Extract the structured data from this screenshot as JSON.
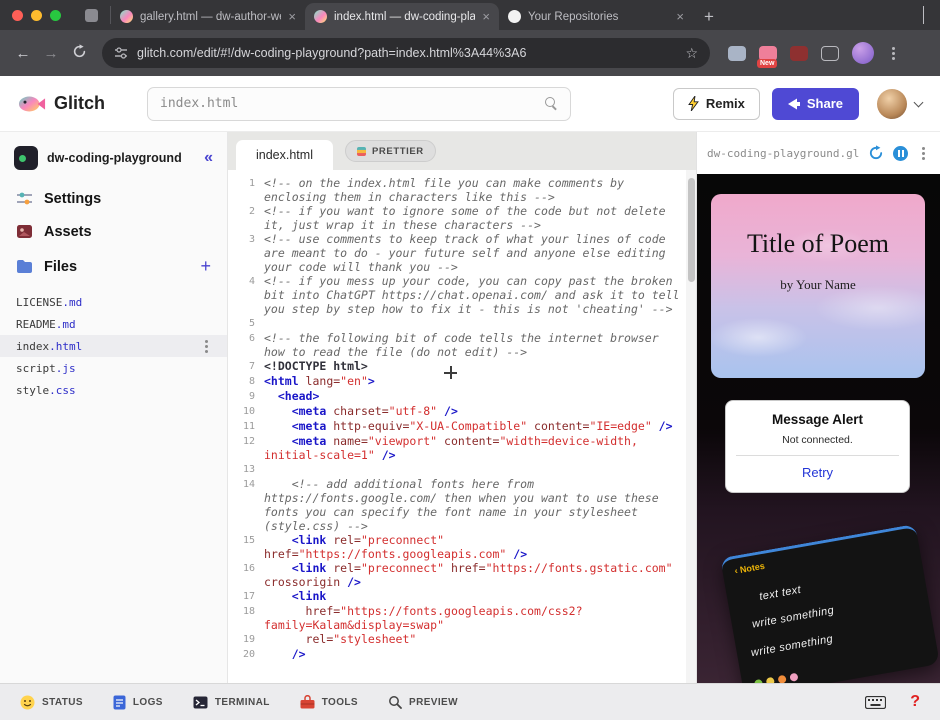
{
  "browser": {
    "tabs": [
      {
        "label": ""
      },
      {
        "label": "gallery.html — dw-author-wel"
      },
      {
        "label": "index.html — dw-coding-play"
      },
      {
        "label": "Your Repositories"
      }
    ],
    "url": "glitch.com/edit/#!/dw-coding-playground?path=index.html%3A44%3A6"
  },
  "header": {
    "brand": "Glitch",
    "search_value": "index.html",
    "remix_label": "Remix",
    "share_label": "Share"
  },
  "sidebar": {
    "project_name": "dw-coding-playground",
    "collapse": "«",
    "nav": [
      {
        "label": "Settings"
      },
      {
        "label": "Assets"
      },
      {
        "label": "Files"
      }
    ],
    "plus": "+",
    "files": [
      {
        "base": "LICENSE",
        "ext": ".md"
      },
      {
        "base": "README",
        "ext": ".md"
      },
      {
        "base": "index",
        "ext": ".html"
      },
      {
        "base": "script",
        "ext": ".js"
      },
      {
        "base": "style",
        "ext": ".css"
      }
    ]
  },
  "editor": {
    "tab_label": "index.html",
    "prettier_label": "PRETTIER",
    "code": [
      {
        "n": "1",
        "segs": [
          {
            "t": "c",
            "s": "<!-- on the index.html file you can make comments by enclosing them in characters like this -->"
          }
        ]
      },
      {
        "n": "2",
        "segs": [
          {
            "t": "c",
            "s": "<!-- if you want to ignore some of the code but not delete it, just wrap it in these characters -->"
          }
        ]
      },
      {
        "n": "3",
        "segs": [
          {
            "t": "c",
            "s": "<!-- use comments to keep track of what your lines of code are meant to do - your future self and anyone else editing your code will thank you -->"
          }
        ]
      },
      {
        "n": "4",
        "segs": [
          {
            "t": "c",
            "s": "<!-- if you mess up your code, you can copy past the broken bit into ChatGPT https://chat.openai.com/ and ask it to tell you step by step how to fix it - this is not 'cheating' -->"
          }
        ]
      },
      {
        "n": "5",
        "segs": []
      },
      {
        "n": "6",
        "segs": [
          {
            "t": "c",
            "s": "<!-- the following bit of code tells the internet browser how to read the file (do not edit) -->"
          }
        ]
      },
      {
        "n": "7",
        "segs": [
          {
            "t": "m",
            "s": "<!DOCTYPE html>"
          }
        ]
      },
      {
        "n": "8",
        "segs": [
          {
            "t": "t",
            "s": "<html"
          },
          {
            "t": "a",
            "s": " lang="
          },
          {
            "t": "s",
            "s": "\"en\""
          },
          {
            "t": "t",
            "s": ">"
          }
        ]
      },
      {
        "n": "9",
        "segs": [
          {
            "t": "p",
            "s": "  "
          },
          {
            "t": "t",
            "s": "<head>"
          }
        ]
      },
      {
        "n": "10",
        "segs": [
          {
            "t": "p",
            "s": "    "
          },
          {
            "t": "t",
            "s": "<meta"
          },
          {
            "t": "a",
            "s": " charset="
          },
          {
            "t": "s",
            "s": "\"utf-8\""
          },
          {
            "t": "t",
            "s": " />"
          }
        ]
      },
      {
        "n": "11",
        "segs": [
          {
            "t": "p",
            "s": "    "
          },
          {
            "t": "t",
            "s": "<meta"
          },
          {
            "t": "a",
            "s": " http-equiv="
          },
          {
            "t": "s",
            "s": "\"X-UA-Compatible\""
          },
          {
            "t": "a",
            "s": " content="
          },
          {
            "t": "s",
            "s": "\"IE=edge\""
          },
          {
            "t": "t",
            "s": " />"
          }
        ]
      },
      {
        "n": "12",
        "segs": [
          {
            "t": "p",
            "s": "    "
          },
          {
            "t": "t",
            "s": "<meta"
          },
          {
            "t": "a",
            "s": " name="
          },
          {
            "t": "s",
            "s": "\"viewport\""
          },
          {
            "t": "a",
            "s": " content="
          },
          {
            "t": "s",
            "s": "\"width=device-width, initial-scale=1\""
          },
          {
            "t": "t",
            "s": " />"
          }
        ]
      },
      {
        "n": "13",
        "segs": []
      },
      {
        "n": "14",
        "segs": [
          {
            "t": "c",
            "s": "    <!-- add additional fonts here from https://fonts.google.com/ then when you want to use these fonts you can specify the font name in your stylesheet (style.css) -->"
          }
        ]
      },
      {
        "n": "15",
        "segs": [
          {
            "t": "p",
            "s": "    "
          },
          {
            "t": "t",
            "s": "<link"
          },
          {
            "t": "a",
            "s": " rel="
          },
          {
            "t": "s",
            "s": "\"preconnect\""
          },
          {
            "t": "a",
            "s": " href="
          },
          {
            "t": "s",
            "s": "\"https://fonts.googleapis.com\""
          },
          {
            "t": "t",
            "s": " />"
          }
        ]
      },
      {
        "n": "16",
        "segs": [
          {
            "t": "p",
            "s": "    "
          },
          {
            "t": "t",
            "s": "<link"
          },
          {
            "t": "a",
            "s": " rel="
          },
          {
            "t": "s",
            "s": "\"preconnect\""
          },
          {
            "t": "a",
            "s": " href="
          },
          {
            "t": "s",
            "s": "\"https://fonts.gstatic.com\""
          },
          {
            "t": "a",
            "s": " crossorigin"
          },
          {
            "t": "t",
            "s": " />"
          }
        ]
      },
      {
        "n": "17",
        "segs": [
          {
            "t": "p",
            "s": "    "
          },
          {
            "t": "t",
            "s": "<link"
          }
        ]
      },
      {
        "n": "18",
        "segs": [
          {
            "t": "a",
            "s": "      href="
          },
          {
            "t": "s",
            "s": "\"https://fonts.googleapis.com/css2?family=Kalam&display=swap\""
          }
        ]
      },
      {
        "n": "19",
        "segs": [
          {
            "t": "a",
            "s": "      rel="
          },
          {
            "t": "s",
            "s": "\"stylesheet\""
          }
        ]
      },
      {
        "n": "20",
        "segs": [
          {
            "t": "p",
            "s": "    "
          },
          {
            "t": "t",
            "s": "/>"
          }
        ]
      }
    ]
  },
  "preview": {
    "domain": "dw-coding-playground.gli",
    "poem": {
      "title": "Title of Poem",
      "author": "by Your Name"
    },
    "alert": {
      "title": "Message Alert",
      "status": "Not connected.",
      "action": "Retry"
    },
    "notes": {
      "tag": "‹ Notes",
      "lines": [
        "text text",
        "write something",
        "write something"
      ]
    }
  },
  "statusbar": {
    "items": [
      "STATUS",
      "LOGS",
      "TERMINAL",
      "TOOLS",
      "PREVIEW"
    ],
    "help": "?"
  }
}
